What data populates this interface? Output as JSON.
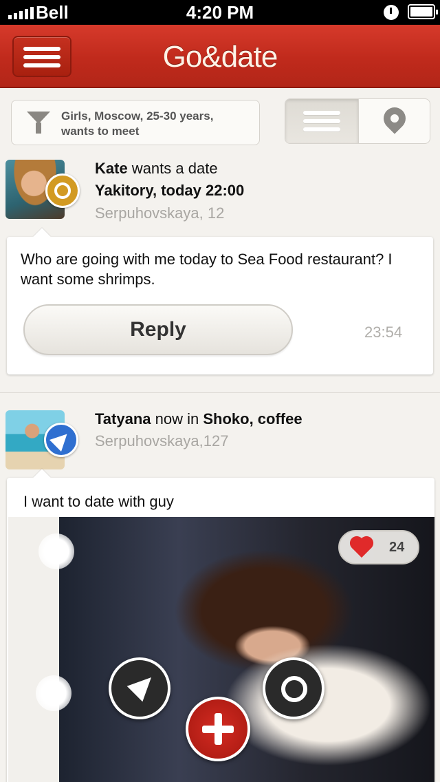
{
  "status_bar": {
    "carrier": "Bell",
    "time": "4:20 PM"
  },
  "header": {
    "title": "Go&date"
  },
  "filter": {
    "line1": "Girls, Moscow, 25-30 years,",
    "line2": "wants to meet"
  },
  "view_toggle": {
    "active": "list"
  },
  "feed": [
    {
      "name": "Kate",
      "action": " wants a date",
      "place": "Yakitory, today 22:00",
      "address": "Serpuhovskaya, 12",
      "message": "Who are going with me today to Sea Food restaurant? I want some shrimps.",
      "reply_label": "Reply",
      "time": "23:54",
      "badge_icon": "date-icon"
    },
    {
      "name": "Tatyana",
      "action": " now in ",
      "place": "Shoko, coffee",
      "address": "Serpuhovskaya,127",
      "message": "I want to date with guy",
      "likes": "24",
      "badge_icon": "navigation-arrow-icon"
    }
  ],
  "colors": {
    "header_red": "#c02a1c",
    "accent_gold": "#d29a22",
    "accent_blue": "#2f6fd0",
    "like_red": "#e02a2a"
  }
}
